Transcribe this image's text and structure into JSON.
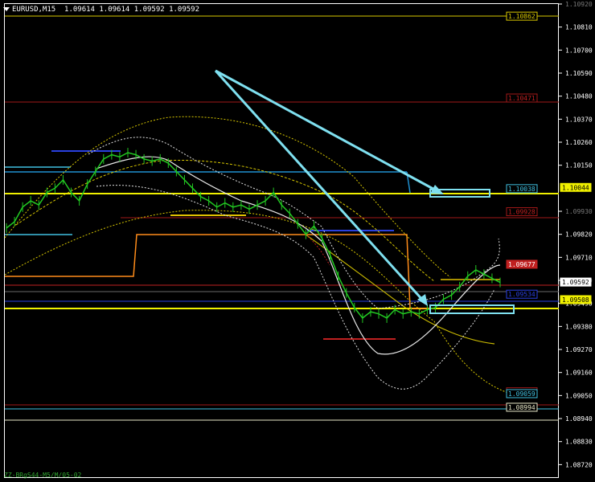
{
  "symbol": "EURUSD,M15",
  "ohlc": "1.09614 1.09614 1.09592 1.09592",
  "footer_text": "ZZ-BRgS44-M5/M/05-02",
  "colors": {
    "background": "#000000",
    "axis": "#ffffff",
    "price_line": "#22c822",
    "ma_white": "#d8d8d8",
    "band_yellow": "#d9c800",
    "orange_line": "#ff8c1a",
    "cyan": "#40c0e0",
    "red": "#c02020",
    "blue": "#2a40e0"
  },
  "axis": {
    "ticks": [
      "1.10810",
      "1.10700",
      "1.10590",
      "1.10480",
      "1.10370",
      "1.10260",
      "1.10150",
      "1.09820",
      "1.09710",
      "1.09490",
      "1.09380",
      "1.09270",
      "1.09160",
      "1.09050",
      "1.08940",
      "1.08830",
      "1.08720"
    ],
    "ticks_partial": [
      "1.10920",
      "1.09930",
      "1.09600"
    ]
  },
  "chart_data": {
    "type": "line",
    "title": "",
    "xlabel": "",
    "ylabel": "",
    "ylim": [
      1.0866,
      1.1092
    ],
    "series": [
      {
        "values": [
          1.0985,
          1.0988,
          1.0995,
          1.0998,
          1.0996,
          1.1002,
          1.1004,
          1.1008,
          1.1002,
          1.0998,
          1.1006,
          1.1012,
          1.1018,
          1.102,
          1.1019,
          1.1021,
          1.102,
          1.1018,
          1.1017,
          1.1018,
          1.1016,
          1.1012,
          1.1008,
          1.1004,
          1.1,
          1.0998,
          1.0995,
          1.0997,
          1.0995,
          1.0996,
          1.0994,
          1.0996,
          1.0998,
          1.1002,
          1.0996,
          1.0992,
          1.0987,
          1.0982,
          1.0986,
          1.098,
          1.0972,
          1.0962,
          1.0954,
          1.0947,
          1.0942,
          1.0945,
          1.0944,
          1.0942,
          1.0946,
          1.0944,
          1.0945,
          1.0944,
          1.0946,
          1.0947,
          1.0951,
          1.0953,
          1.0957,
          1.0962,
          1.0965,
          1.0963,
          1.0961,
          1.0959
        ]
      }
    ],
    "price_levels": [
      {
        "label": "1.10862",
        "value": 1.10862
      },
      {
        "label": "1.10471",
        "value": 1.10471
      },
      {
        "label": "1.10038",
        "value": 1.10038
      },
      {
        "label": "1.10044",
        "value": 1.10044
      },
      {
        "label": "1.09928",
        "value": 1.09928
      },
      {
        "label": "1.09677",
        "value": 1.09677
      },
      {
        "label": "1.09592",
        "value": 1.09592
      },
      {
        "label": "1.09534",
        "value": 1.09534
      },
      {
        "label": "1.09508",
        "value": 1.09508
      },
      {
        "label": "1.09068",
        "value": 1.09068
      },
      {
        "label": "1.09059",
        "value": 1.09059
      },
      {
        "label": "1.08994",
        "value": 1.08994
      }
    ]
  }
}
